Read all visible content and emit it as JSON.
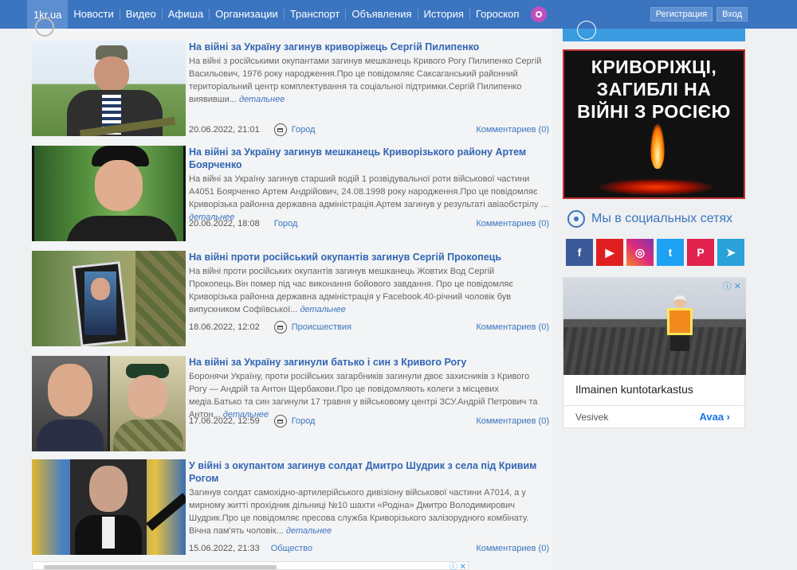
{
  "nav": {
    "brand": "1kr.ua",
    "items": [
      "Новости",
      "Видео",
      "Афиша",
      "Организации",
      "Транспорт",
      "Объявления",
      "История",
      "Гороскоп"
    ],
    "register": "Регистрация",
    "login": "Вход"
  },
  "news": [
    {
      "title": "На війні за Україну загинув криворіжець Сергій Пилипенко",
      "text": "На війні з російськими окупантами загинув мешканець Кривого Рогу Пилипенко Сергій Васильович, 1976 року народження.Про це повідомляє Саксаганський районний територіальний центр комплектування та соціальної підтримки.Сергій Пилипенко виявивши...",
      "more": "детальнее",
      "date": "20.06.2022, 21:01",
      "category": "Город",
      "comments": "Комментариев (0)"
    },
    {
      "title": "На війні за Україну загинув мешканець Криворізького району Артем Боярченко",
      "text": "На війні за Україну загинув старший водій 1 розвідувальної роти військової частини А4051 Боярченко Артем Андрійович, 24.08.1998 року народження.Про це повідомляє Криворізька районна державна адміністрація.Артем загинув у результаті авіаобстрілу ...",
      "more": "детальнее",
      "date": "20.06.2022, 18:08",
      "category": "Город",
      "comments": "Комментариев (0)"
    },
    {
      "title": "На війні проти російський окупантів загинув Сергій Прокопець",
      "text": "На війні проти російських окупантів загинув мешканець Жовтих Вод Сергій Прокопець.Він помер під час виконання бойового завдання. Про це повідомляє Криворізька районна державна адміністрація у Facebook.40-річний чоловік був випускником Софіївської...",
      "more": "детальнее",
      "date": "18.06.2022, 12:02",
      "category": "Происшествия",
      "comments": "Комментариев (0)"
    },
    {
      "title": "На війні за Україну загинули батько і син з Кривого Рогу",
      "text": "Боронячи Україну, проти російських загарбників загинули двоє захисників з Кривого Рогу — Андрій та Антон Щербакови.Про це повідомляють колеги з місцевих медіа.Батько та син загинули 17 травня у військовому центрі ЗСУ.Андрій Петрович та Антон...",
      "more": "детальнее",
      "date": "17.06.2022, 12:59",
      "category": "Город",
      "comments": "Комментариев (0)"
    },
    {
      "title": "У війні з окупантом загинув солдат Дмитро Шудрик з села під Кривим Рогом",
      "text": "Загинув солдат самохідно-артилерійського дивізіону військової частини А7014, а у мирному житті прохідник дільниці №10 шахти «Родіна» Дмитро Володимирович Шудрик.Про це повідомляє пресова служба Криворізького залізорудного комбінату. Вічна пам'ять чоловік...",
      "more": "детальнее",
      "date": "15.06.2022, 21:33",
      "category": "Общество",
      "comments": "Комментариев (0)"
    }
  ],
  "sidebar": {
    "banner_text": "КРИВОРІЖЦІ, ЗАГИБЛІ НА ВІЙНІ З РОСІЄЮ",
    "social_title": "Мы в социальных сетях",
    "socials": [
      {
        "name": "facebook",
        "glyph": "f",
        "color": "#3b5998"
      },
      {
        "name": "youtube",
        "glyph": "▶",
        "color": "#e02020"
      },
      {
        "name": "instagram",
        "glyph": "◎",
        "color": "#c13584"
      },
      {
        "name": "twitter",
        "glyph": "t",
        "color": "#1da1f2"
      },
      {
        "name": "pinterest",
        "glyph": "P",
        "color": "#e0224c"
      },
      {
        "name": "telegram",
        "glyph": "➤",
        "color": "#2aa1d8"
      }
    ],
    "ad": {
      "title": "Ilmainen kuntotarkastus",
      "source": "Vesivek",
      "cta": "Avaa ›",
      "close": "ⓘ ✕"
    }
  },
  "bottom_ad": {
    "close": "ⓘ ✕"
  }
}
